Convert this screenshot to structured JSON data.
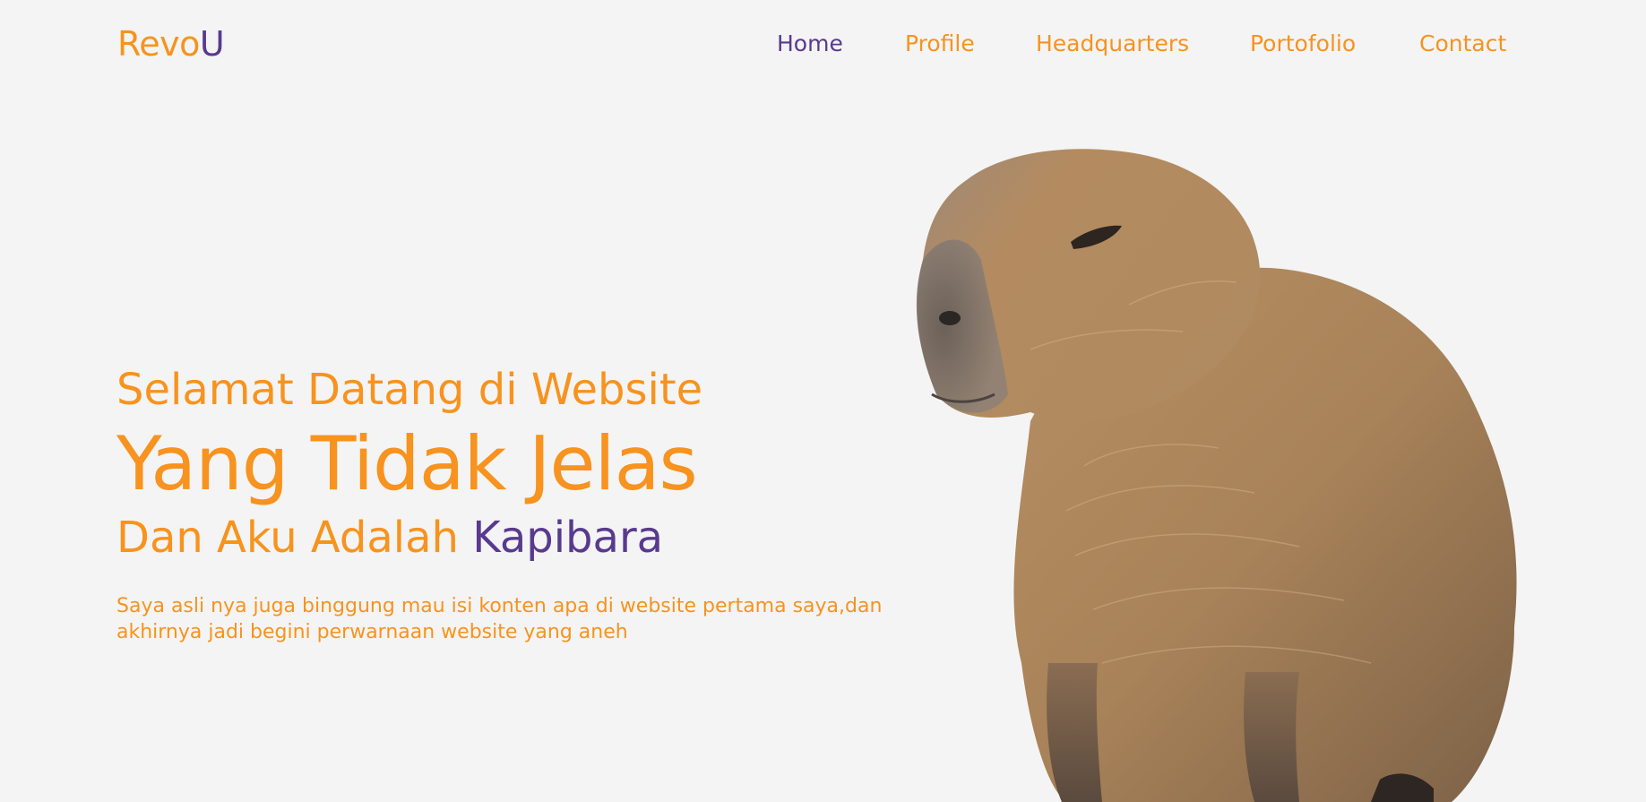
{
  "brand": {
    "part1": "Revo",
    "part2": "U",
    "color_primary": "#f7931e",
    "color_secondary": "#583a8e"
  },
  "nav": {
    "items": [
      {
        "label": "Home",
        "active": true
      },
      {
        "label": "Profile",
        "active": false
      },
      {
        "label": "Headquarters",
        "active": false
      },
      {
        "label": "Portofolio",
        "active": false
      },
      {
        "label": "Contact",
        "active": false
      }
    ]
  },
  "hero": {
    "line1": "Selamat Datang di Website",
    "line2": "Yang Tidak Jelas",
    "line3_prefix": "Dan Aku Adalah ",
    "line3_accent": "Kapibara",
    "description": "Saya asli nya juga binggung mau isi konten apa di website pertama saya,dan akhirnya jadi begini perwarnaan website yang aneh",
    "image_icon": "capybara-photo"
  },
  "colors": {
    "background": "#f4f4f4",
    "orange": "#f7931e",
    "purple": "#583a8e"
  }
}
